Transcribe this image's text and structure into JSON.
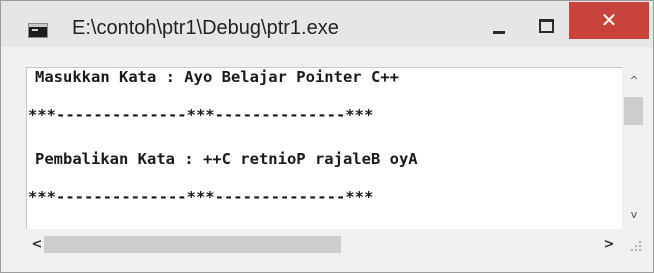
{
  "window": {
    "title": "E:\\contoh\\ptr1\\Debug\\ptr1.exe",
    "icon": "console-app-icon",
    "buttons": {
      "minimize": "minimize",
      "maximize": "maximize",
      "close_glyph": "✕"
    },
    "colors": {
      "close_button": "#c7423a",
      "titlebar": "#e6e6e6",
      "console_bg": "#ffffff",
      "text": "#1a1a1a"
    }
  },
  "console": {
    "lines": [
      "Masukkan Kata : Ayo Belajar Pointer C++",
      "***--------------***--------------***",
      "Pembalikan Kata : ++C retnioP rajaleB oyA",
      "***--------------***--------------***"
    ]
  },
  "scrollbars": {
    "vertical": {
      "up_glyph": "^",
      "down_glyph": "v"
    },
    "horizontal": {
      "left_glyph": "<",
      "right_glyph": ">"
    }
  }
}
